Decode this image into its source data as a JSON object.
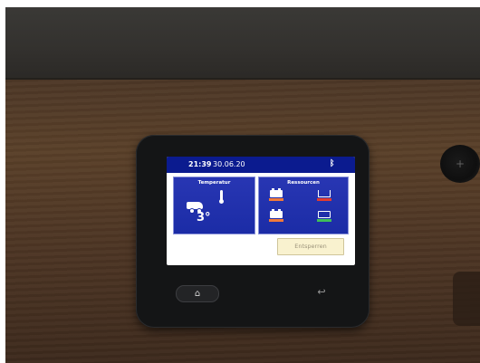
{
  "status_bar": {
    "time": "21:39",
    "date": "30.06.20",
    "bluetooth_icon": "bluetooth-icon"
  },
  "temperature_tile": {
    "title": "Temperatur",
    "value": "3°",
    "icons": [
      "thermometer-icon",
      "camper-van-icon"
    ]
  },
  "resources_tile": {
    "title": "Ressourcen",
    "items": [
      {
        "icon": "battery-icon",
        "level_color": "#f07a3a"
      },
      {
        "icon": "waste-water-tank-icon",
        "level_color": "#e23b2f"
      },
      {
        "icon": "battery-icon",
        "level_color": "#f07a3a"
      },
      {
        "icon": "grey-water-tank-icon",
        "level_color": "#3fbf58"
      }
    ]
  },
  "unlock_button": {
    "label": "Entsperren"
  },
  "hardware_buttons": {
    "home": {
      "icon": "home-icon",
      "glyph": "⌂"
    },
    "back": {
      "icon": "back-arrow-icon",
      "glyph": "↩"
    }
  },
  "colors": {
    "header_bg": "#0b1b8f",
    "tile_bg": "#1b2ca6",
    "unlock_bg": "#f9f2cf"
  }
}
